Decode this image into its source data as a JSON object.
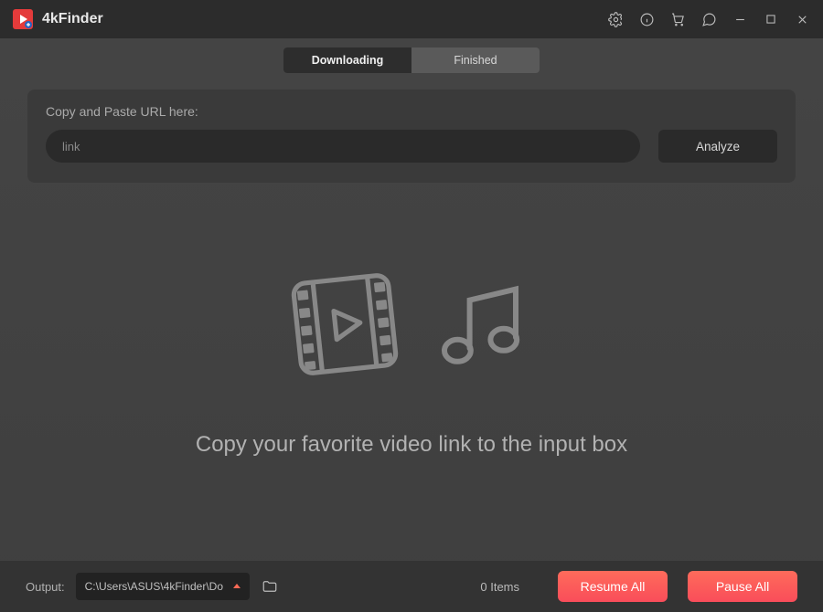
{
  "header": {
    "title": "4kFinder"
  },
  "tabs": {
    "downloading": "Downloading",
    "finished": "Finished"
  },
  "url": {
    "label": "Copy and Paste URL here:",
    "placeholder": "link",
    "value": "",
    "analyze": "Analyze"
  },
  "empty": {
    "message": "Copy your favorite video link to the input box"
  },
  "footer": {
    "output_label": "Output:",
    "output_path": "C:\\Users\\ASUS\\4kFinder\\Do",
    "items_count": "0 Items",
    "resume": "Resume All",
    "pause": "Pause All"
  }
}
